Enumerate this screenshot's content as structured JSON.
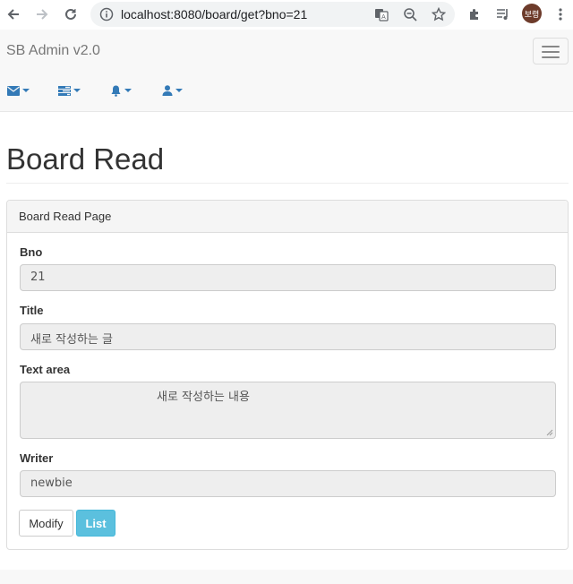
{
  "browser": {
    "url": "localhost:8080/board/get?bno=21",
    "profile_initials": "보령"
  },
  "navbar": {
    "brand": "SB Admin v2.0",
    "icons": [
      "envelope-icon",
      "tasks-icon",
      "bell-icon",
      "user-icon"
    ]
  },
  "page": {
    "title": "Board Read"
  },
  "panel": {
    "heading": "Board Read Page",
    "fields": {
      "bno_label": "Bno",
      "bno_value": "21",
      "title_label": "Title",
      "title_value": "새로 작성하는 글",
      "content_label": "Text area",
      "content_value": "새로 작성하는 내용",
      "writer_label": "Writer",
      "writer_value": "newbie"
    },
    "buttons": {
      "modify": "Modify",
      "list": "List"
    }
  },
  "colors": {
    "accent": "#337ab7",
    "info_button": "#5bc0de",
    "navbar_bg": "#f8f8f8",
    "readonly_bg": "#eeeeee"
  }
}
